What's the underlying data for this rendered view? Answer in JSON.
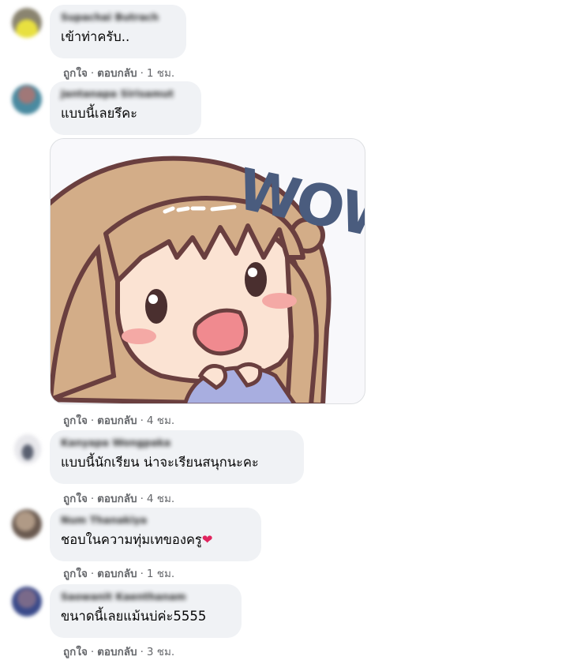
{
  "comments": [
    {
      "author": "Supachai Butrach",
      "text": "เข้าท่าครับ..",
      "like": "ถูกใจ",
      "reply": "ตอบกลับ",
      "time": "1 ชม.",
      "avatar_color": "#d8c84a"
    },
    {
      "author": "Jantanapa Sirisamut",
      "text": "แบบนี้เลยรึคะ",
      "like": "ถูกใจ",
      "reply": "ตอบกลับ",
      "time": "4 ชม.",
      "avatar_color": "#a07878",
      "sticker": {
        "caption": "WOW"
      }
    },
    {
      "author": "Kanyapa Wongpaka",
      "text": "แบบนี้นักเรียน น่าจะเรียนสนุกนะคะ",
      "like": "ถูกใจ",
      "reply": "ตอบกลับ",
      "time": "4 ชม.",
      "avatar_color": "#6a7080"
    },
    {
      "author": "Num Thanakiya",
      "text": "ชอบในความทุ่มเทของครู",
      "like": "ถูกใจ",
      "reply": "ตอบกลับ",
      "time": "1 ชม.",
      "avatar_color": "#8a7464"
    },
    {
      "author": "Saowanit Kaenthanam",
      "text": "ขนาดนี้เลยแม้นบ่ค่ะ5555",
      "like": "ถูกใจ",
      "reply": "ตอบกลับ",
      "time": "3 ชม.",
      "avatar_color": "#5a6a9a"
    }
  ],
  "separator": "·"
}
